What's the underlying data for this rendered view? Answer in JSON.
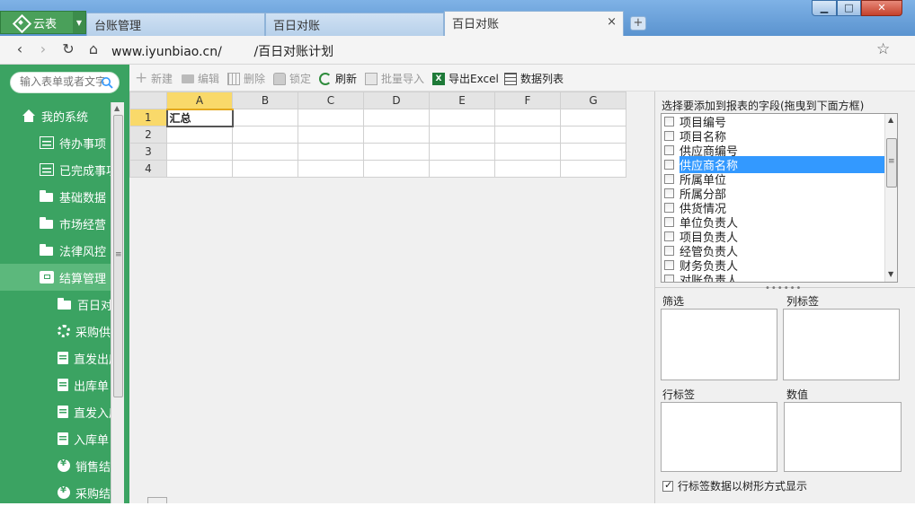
{
  "window": {
    "minimize": "▁",
    "maximize": "□",
    "close": "✕"
  },
  "app": {
    "name": "云表",
    "caret": "▼"
  },
  "tabs": [
    {
      "label": "台账管理"
    },
    {
      "label": "百日对账"
    },
    {
      "label": "百日对账",
      "close": "×"
    }
  ],
  "new_tab": "+",
  "address": {
    "url": "www.iyunbiao.cn/        /百日对账计划"
  },
  "sidebar": {
    "search_placeholder": "输入表单或者文字",
    "items": [
      {
        "label": "我的系统",
        "icon": "home-icon"
      },
      {
        "label": "待办事项",
        "icon": "list-icon"
      },
      {
        "label": "已完成事项",
        "icon": "list-icon"
      },
      {
        "label": "基础数据",
        "icon": "folder-icon"
      },
      {
        "label": "市场经营",
        "icon": "folder-icon"
      },
      {
        "label": "法律风控",
        "icon": "folder-icon"
      },
      {
        "label": "结算管理",
        "icon": "box-icon"
      },
      {
        "label": "百日对账",
        "icon": "folder-icon"
      },
      {
        "label": "采购供货",
        "icon": "gear-icon"
      },
      {
        "label": "直发出库",
        "icon": "doc-icon"
      },
      {
        "label": "出库单",
        "icon": "doc-icon"
      },
      {
        "label": "直发入库",
        "icon": "doc-icon"
      },
      {
        "label": "入库单",
        "icon": "doc-icon"
      },
      {
        "label": "销售结算",
        "icon": "badge-icon"
      },
      {
        "label": "采购结算",
        "icon": "badge-icon"
      }
    ]
  },
  "toolbar": {
    "new": "新建",
    "edit": "编辑",
    "delete": "删除",
    "lock": "锁定",
    "refresh": "刷新",
    "import": "批量导入",
    "export": "导出Excel",
    "datalist": "数据列表",
    "xls_glyph": "X"
  },
  "sheet": {
    "columns": [
      "A",
      "B",
      "C",
      "D",
      "E",
      "F",
      "G"
    ],
    "rows": [
      "1",
      "2",
      "3",
      "4"
    ],
    "cells": {
      "A1": "汇总"
    }
  },
  "fields_panel": {
    "caption": "选择要添加到报表的字段(拖曳到下面方框)",
    "fields": [
      "项目编号",
      "项目名称",
      "供应商编号",
      "供应商名称",
      "所属单位",
      "所属分部",
      "供货情况",
      "单位负责人",
      "项目负责人",
      "经管负责人",
      "财务负责人",
      "对账负责人"
    ],
    "selected_field": "供应商名称",
    "zones": {
      "filter": "筛选",
      "column_labels": "列标签",
      "row_labels": "行标签",
      "values": "数值"
    },
    "tree_option": "行标签数据以树形方式显示"
  },
  "colors": {
    "sidebar": "#3ba362",
    "accent": "#3399ff",
    "column_highlight": "#f9d96a"
  }
}
